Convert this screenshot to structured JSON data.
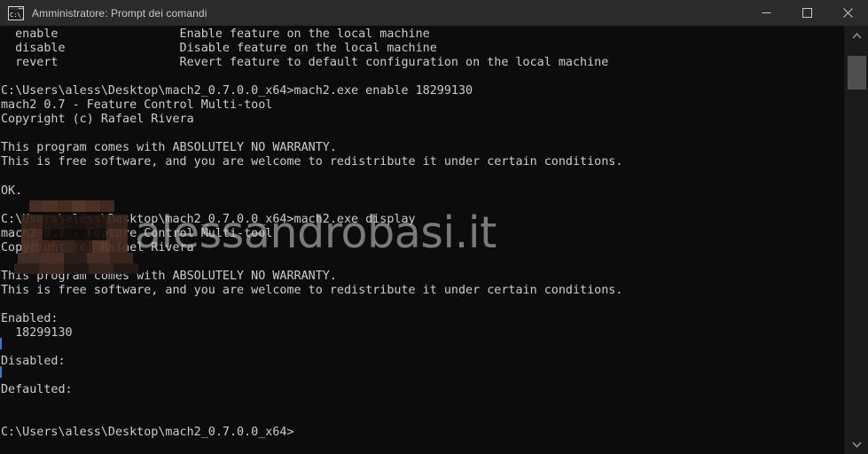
{
  "window": {
    "title": "Amministratore: Prompt dei comandi",
    "icon": "console-cmd-icon",
    "controls": {
      "minimize": "minimize-icon",
      "maximize": "maximize-icon",
      "close": "close-icon"
    },
    "colors": {
      "titlebar_bg": "#2b2b2b",
      "console_bg": "#0c0c0c",
      "text": "#cccccc",
      "scrollbar_bg": "#1b1b1b",
      "scrollbar_thumb": "#4f4f4f",
      "close_hover": "#c42b1c",
      "caret": "#3b78c8",
      "redaction": "#4a3128"
    }
  },
  "scrollbar": {
    "up_arrow": "chevron-up-icon",
    "down_arrow": "chevron-down-icon",
    "thumb_label": "scrollbar-thumb"
  },
  "watermark": {
    "text": "alessandrobasi.it"
  },
  "terminal": {
    "lines": [
      "  enable                 Enable feature on the local machine",
      "  disable                Disable feature on the local machine",
      "  revert                 Revert feature to default configuration on the local machine",
      "",
      "C:\\Users\\aless\\Desktop\\mach2_0.7.0.0_x64>mach2.exe enable 18299130",
      "mach2 0.7 - Feature Control Multi-tool",
      "Copyright (c) Rafael Rivera",
      "",
      "This program comes with ABSOLUTELY NO WARRANTY.",
      "This is free software, and you are welcome to redistribute it under certain conditions.",
      "",
      "OK.",
      "",
      "C:\\Users\\aless\\Desktop\\mach2_0.7.0.0_x64>mach2.exe display",
      "mach2 0.7 - Feature Control Multi-tool",
      "Copyright (c) Rafael Rivera",
      "",
      "This program comes with ABSOLUTELY NO WARRANTY.",
      "This is free software, and you are welcome to redistribute it under certain conditions.",
      "",
      "Enabled:",
      "  18299130",
      "",
      "Disabled:",
      "",
      "Defaulted:",
      "",
      "",
      "C:\\Users\\aless\\Desktop\\mach2_0.7.0.0_x64>"
    ]
  }
}
